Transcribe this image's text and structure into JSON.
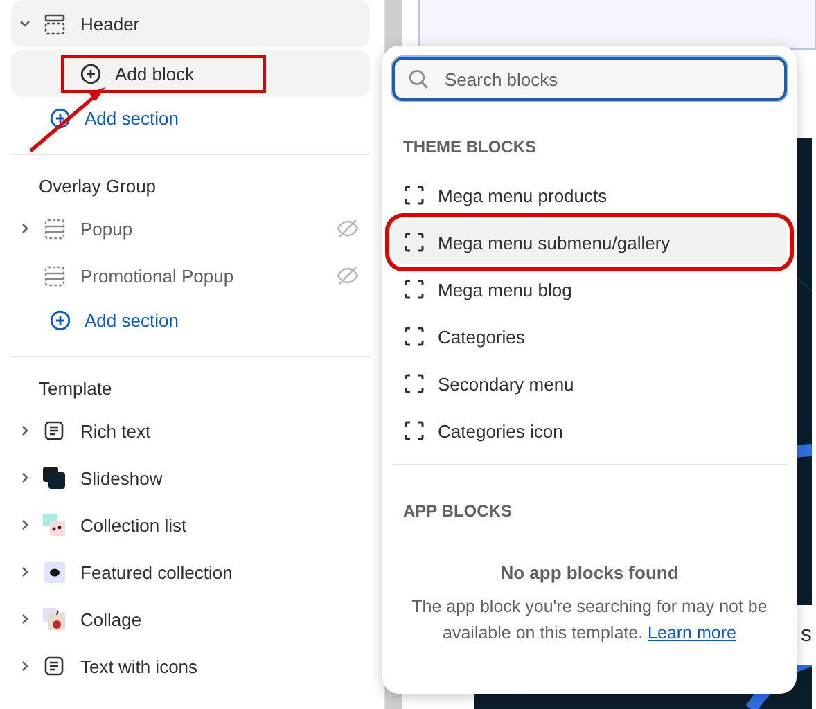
{
  "groups": [
    {
      "items": [
        {
          "label": "Header",
          "kind": "header",
          "expandable": true,
          "expanded": true,
          "hidden": false,
          "children": [
            {
              "label": "Add block",
              "annotated": true
            }
          ]
        }
      ],
      "add_section": "Add section"
    },
    {
      "title": "Overlay Group",
      "items": [
        {
          "label": "Popup",
          "kind": "popup",
          "expandable": true,
          "expanded": false,
          "hidden": true
        },
        {
          "label": "Promotional Popup",
          "kind": "popup",
          "expandable": false,
          "expanded": false,
          "hidden": true
        }
      ],
      "add_section": "Add section"
    },
    {
      "title": "Template",
      "items": [
        {
          "label": "Rich text",
          "kind": "text",
          "expandable": true,
          "expanded": false,
          "hidden": false
        },
        {
          "label": "Slideshow",
          "kind": "slideshow",
          "expandable": true,
          "expanded": false,
          "hidden": false
        },
        {
          "label": "Collection list",
          "kind": "collection-list",
          "expandable": true,
          "expanded": false,
          "hidden": false
        },
        {
          "label": "Featured collection",
          "kind": "featured-collection",
          "expandable": true,
          "expanded": false,
          "hidden": false
        },
        {
          "label": "Collage",
          "kind": "collage",
          "expandable": true,
          "expanded": false,
          "hidden": false
        },
        {
          "label": "Text with icons",
          "kind": "text",
          "expandable": true,
          "expanded": false,
          "hidden": false
        }
      ]
    }
  ],
  "preview": {
    "band_text": "s"
  },
  "block_picker": {
    "search": {
      "placeholder": "Search blocks"
    },
    "sections": [
      {
        "title": "THEME BLOCKS",
        "items": [
          {
            "label": "Mega menu products",
            "hovered": false,
            "annotated": false
          },
          {
            "label": "Mega menu submenu/gallery",
            "hovered": true,
            "annotated": true
          },
          {
            "label": "Mega menu blog",
            "hovered": false,
            "annotated": false
          },
          {
            "label": "Categories",
            "hovered": false,
            "annotated": false
          },
          {
            "label": "Secondary menu",
            "hovered": false,
            "annotated": false
          },
          {
            "label": "Categories icon",
            "hovered": false,
            "annotated": false
          }
        ]
      },
      {
        "title": "APP BLOCKS",
        "empty": {
          "title": "No app blocks found",
          "text": "The app block you're searching for may not be available on this template.",
          "link": "Learn more"
        }
      }
    ]
  }
}
